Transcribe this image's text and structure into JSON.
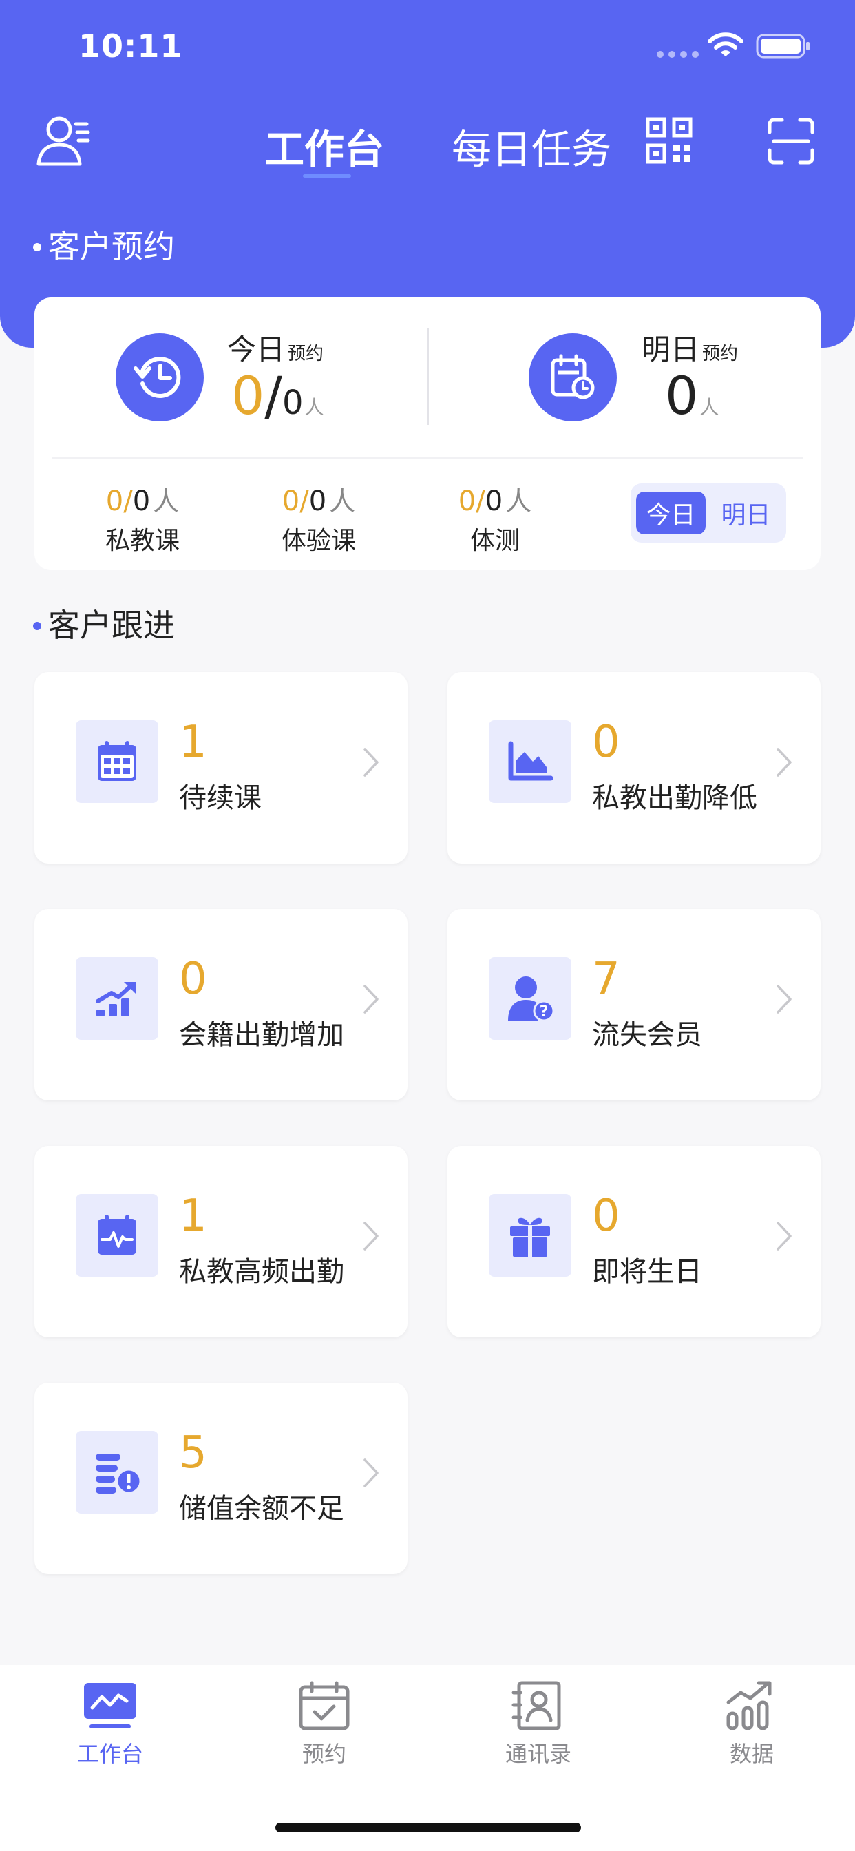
{
  "status_bar": {
    "time": "10:11"
  },
  "header": {
    "tabs": [
      {
        "label": "工作台",
        "active": true
      },
      {
        "label": "每日任务",
        "active": false
      }
    ]
  },
  "appointments": {
    "title": "客户预约",
    "today": {
      "label": "今日",
      "sub": "预约",
      "done": "0",
      "sep": "/",
      "total": "0",
      "unit": "人"
    },
    "tomorrow": {
      "label": "明日",
      "sub": "预约",
      "total": "0",
      "unit": "人"
    },
    "stats": [
      {
        "done": "0",
        "sep": "/",
        "total": "0",
        "unit": "人",
        "label": "私教课"
      },
      {
        "done": "0",
        "sep": "/",
        "total": "0",
        "unit": "人",
        "label": "体验课"
      },
      {
        "done": "0",
        "sep": "/",
        "total": "0",
        "unit": "人",
        "label": "体测"
      }
    ],
    "toggle": {
      "today": "今日",
      "tomorrow": "明日",
      "selected": "今日"
    }
  },
  "followup": {
    "title": "客户跟进",
    "cards": [
      {
        "count": "1",
        "label": "待续课",
        "icon": "calendar-icon"
      },
      {
        "count": "0",
        "label": "私教出勤降低",
        "icon": "trend-down-icon"
      },
      {
        "count": "0",
        "label": "会籍出勤增加",
        "icon": "trend-up-icon"
      },
      {
        "count": "7",
        "label": "流失会员",
        "icon": "lost-member-icon"
      },
      {
        "count": "1",
        "label": "私教高频出勤",
        "icon": "pulse-calendar-icon"
      },
      {
        "count": "0",
        "label": "即将生日",
        "icon": "gift-icon"
      },
      {
        "count": "5",
        "label": "储值余额不足",
        "icon": "low-balance-icon"
      }
    ]
  },
  "bottom_nav": [
    {
      "label": "工作台",
      "icon": "dashboard-icon",
      "active": true
    },
    {
      "label": "预约",
      "icon": "calendar-check-icon",
      "active": false
    },
    {
      "label": "通讯录",
      "icon": "contacts-icon",
      "active": false
    },
    {
      "label": "数据",
      "icon": "chart-icon",
      "active": false
    }
  ],
  "colors": {
    "primary": "#5865f2",
    "accent": "#e6a82e",
    "icon_bg": "#e9ebfd",
    "page_bg": "#f7f7f9"
  }
}
